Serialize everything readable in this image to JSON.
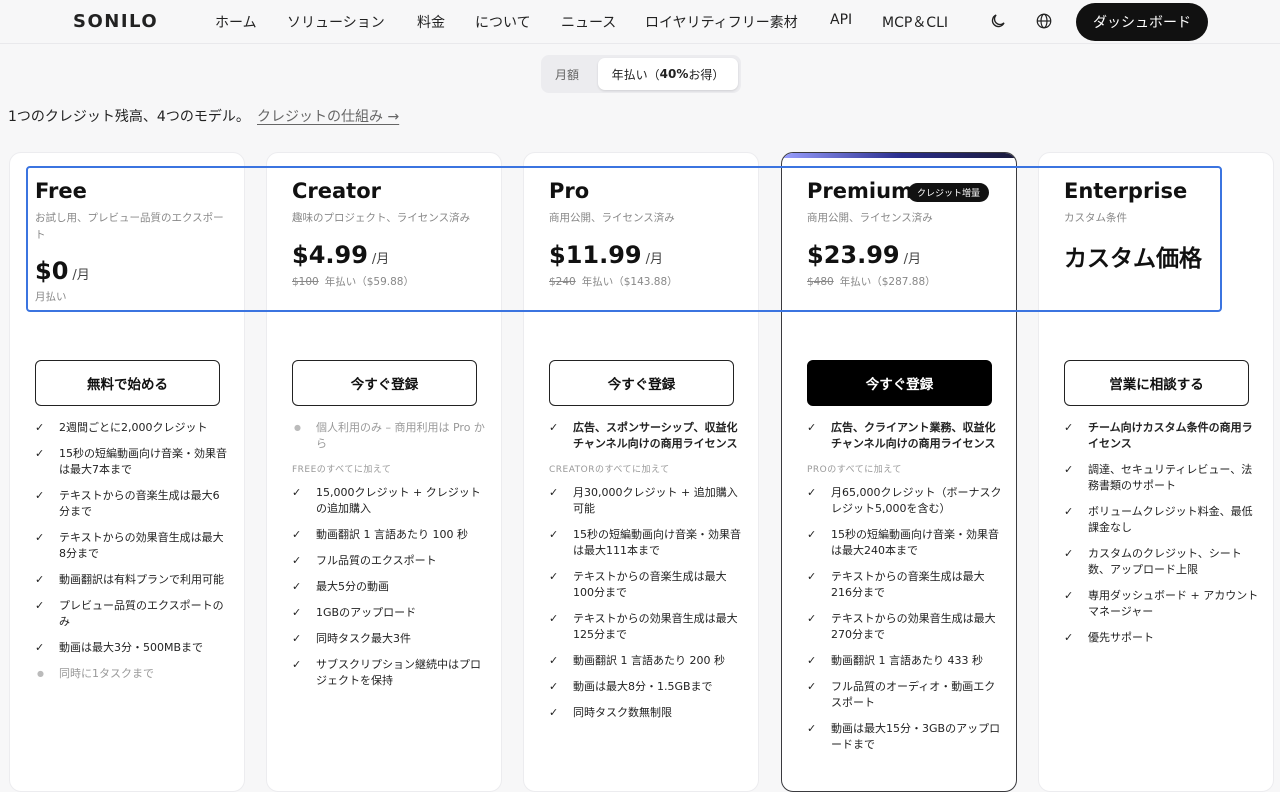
{
  "nav": {
    "logo": "SONILO",
    "items": [
      "ホーム",
      "ソリューション",
      "料金",
      "について",
      "ニュース",
      "ロイヤリティフリー素材",
      "API",
      "MCP＆CLI"
    ],
    "dashboard": "ダッシュボード",
    "icons": [
      "moon-icon",
      "globe-icon"
    ]
  },
  "billing": {
    "monthly": "月額",
    "annual_prefix": "年払い（",
    "annual_bold": "40%",
    "annual_suffix": " お得）"
  },
  "intro": {
    "text": "1つのクレジット残高、4つのモデル。",
    "link": "クレジットの仕組み →"
  },
  "plans": [
    {
      "name": "Free",
      "desc": "お試し用、プレビュー品質のエクスポート",
      "amount": "$0",
      "per": "/月",
      "sub_note": "月払い",
      "cta": "無料で始める",
      "features": [
        "2週間ごとに2,000クレジット",
        "15秒の短編動画向け音楽・効果音は最大7本まで",
        "テキストからの音楽生成は最大6分まで",
        "テキストからの効果音生成は最大8分まで",
        "動画翻訳は有料プランで利用可能",
        "プレビュー品質のエクスポートのみ",
        "動画は最大3分・500MBまで"
      ],
      "muted": [
        "同時に1タスクまで"
      ]
    },
    {
      "name": "Creator",
      "desc": "趣味のプロジェクト、ライセンス済み",
      "amount": "$4.99",
      "per": "/月",
      "strike": "$100",
      "annual": "年払い（$59.88）",
      "cta": "今すぐ登録",
      "muted": [
        "個人利用のみ – 商用利用は Pro から"
      ],
      "section": "FREEのすべてに加えて",
      "features": [
        "15,000クレジット + クレジットの追加購入",
        "動画翻訳 1 言語あたり 100 秒",
        "フル品質のエクスポート",
        "最大5分の動画",
        "1GBのアップロード",
        "同時タスク最大3件",
        "サブスクリプション継続中はプロジェクトを保持"
      ]
    },
    {
      "name": "Pro",
      "desc": "商用公開、ライセンス済み",
      "amount": "$11.99",
      "per": "/月",
      "strike": "$240",
      "annual": "年払い（$143.88）",
      "cta": "今すぐ登録",
      "bold_features": [
        "広告、スポンサーシップ、収益化チャンネル向けの商用ライセンス"
      ],
      "section": "CREATORのすべてに加えて",
      "features": [
        "月30,000クレジット + 追加購入可能",
        "15秒の短編動画向け音楽・効果音は最大111本まで",
        "テキストからの音楽生成は最大100分まで",
        "テキストからの効果音生成は最大125分まで",
        "動画翻訳 1 言語あたり 200 秒",
        "動画は最大8分・1.5GBまで",
        "同時タスク数無制限"
      ]
    },
    {
      "name": "Premium",
      "badge": "クレジット増量",
      "desc": "商用公開、ライセンス済み",
      "amount": "$23.99",
      "per": "/月",
      "strike": "$480",
      "annual": "年払い（$287.88）",
      "cta": "今すぐ登録",
      "bold_features": [
        "広告、クライアント業務、収益化チャンネル向けの商用ライセンス"
      ],
      "section": "PROのすべてに加えて",
      "features": [
        "月65,000クレジット（ボーナスクレジット5,000を含む）",
        "15秒の短編動画向け音楽・効果音は最大240本まで",
        "テキストからの音楽生成は最大216分まで",
        "テキストからの効果音生成は最大270分まで",
        "動画翻訳 1 言語あたり 433 秒",
        "フル品質のオーディオ・動画エクスポート",
        "動画は最大15分・3GBのアップロードまで"
      ]
    },
    {
      "name": "Enterprise",
      "desc": "カスタム条件",
      "custom_price": "カスタム価格",
      "cta": "営業に相談する",
      "bold_features": [
        "チーム向けカスタム条件の商用ライセンス"
      ],
      "features": [
        "調達、セキュリティレビュー、法務書類のサポート",
        "ボリュームクレジット料金、最低課金なし",
        "カスタムのクレジット、シート数、アップロード上限",
        "専用ダッシュボード + アカウントマネージャー",
        "優先サポート"
      ]
    }
  ],
  "colors": {
    "highlight": "#3b74e0",
    "cta_dark": "#000000",
    "background": "#f7f7f8"
  }
}
